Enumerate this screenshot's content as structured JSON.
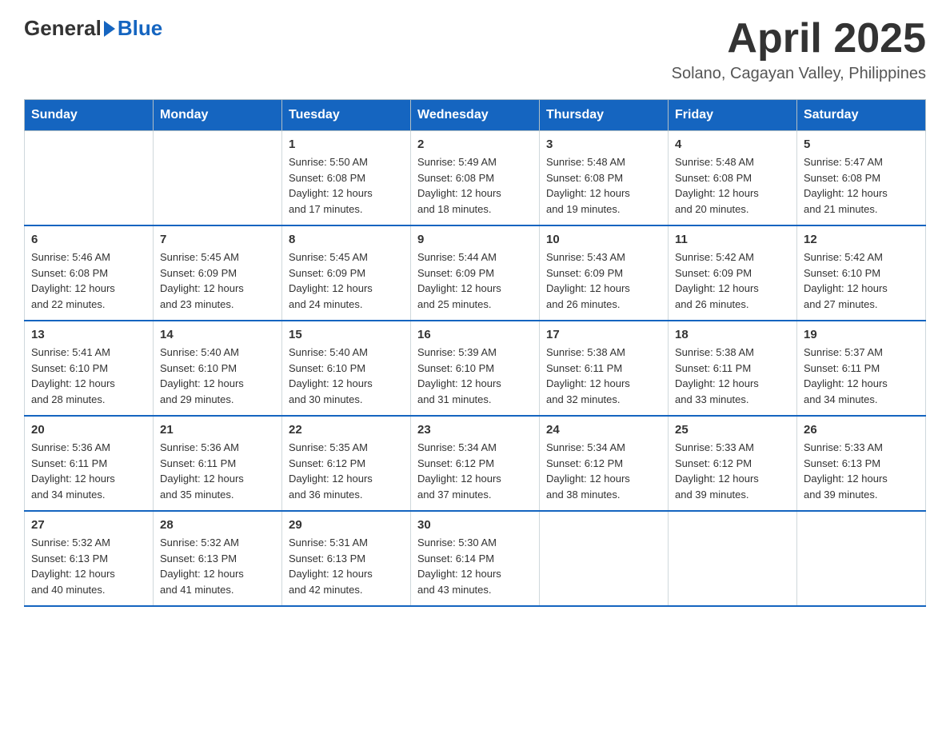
{
  "header": {
    "logo": {
      "general": "General",
      "blue": "Blue"
    },
    "title": "April 2025",
    "subtitle": "Solano, Cagayan Valley, Philippines"
  },
  "calendar": {
    "days_of_week": [
      "Sunday",
      "Monday",
      "Tuesday",
      "Wednesday",
      "Thursday",
      "Friday",
      "Saturday"
    ],
    "weeks": [
      [
        {
          "day": "",
          "info": ""
        },
        {
          "day": "",
          "info": ""
        },
        {
          "day": "1",
          "info": "Sunrise: 5:50 AM\nSunset: 6:08 PM\nDaylight: 12 hours\nand 17 minutes."
        },
        {
          "day": "2",
          "info": "Sunrise: 5:49 AM\nSunset: 6:08 PM\nDaylight: 12 hours\nand 18 minutes."
        },
        {
          "day": "3",
          "info": "Sunrise: 5:48 AM\nSunset: 6:08 PM\nDaylight: 12 hours\nand 19 minutes."
        },
        {
          "day": "4",
          "info": "Sunrise: 5:48 AM\nSunset: 6:08 PM\nDaylight: 12 hours\nand 20 minutes."
        },
        {
          "day": "5",
          "info": "Sunrise: 5:47 AM\nSunset: 6:08 PM\nDaylight: 12 hours\nand 21 minutes."
        }
      ],
      [
        {
          "day": "6",
          "info": "Sunrise: 5:46 AM\nSunset: 6:08 PM\nDaylight: 12 hours\nand 22 minutes."
        },
        {
          "day": "7",
          "info": "Sunrise: 5:45 AM\nSunset: 6:09 PM\nDaylight: 12 hours\nand 23 minutes."
        },
        {
          "day": "8",
          "info": "Sunrise: 5:45 AM\nSunset: 6:09 PM\nDaylight: 12 hours\nand 24 minutes."
        },
        {
          "day": "9",
          "info": "Sunrise: 5:44 AM\nSunset: 6:09 PM\nDaylight: 12 hours\nand 25 minutes."
        },
        {
          "day": "10",
          "info": "Sunrise: 5:43 AM\nSunset: 6:09 PM\nDaylight: 12 hours\nand 26 minutes."
        },
        {
          "day": "11",
          "info": "Sunrise: 5:42 AM\nSunset: 6:09 PM\nDaylight: 12 hours\nand 26 minutes."
        },
        {
          "day": "12",
          "info": "Sunrise: 5:42 AM\nSunset: 6:10 PM\nDaylight: 12 hours\nand 27 minutes."
        }
      ],
      [
        {
          "day": "13",
          "info": "Sunrise: 5:41 AM\nSunset: 6:10 PM\nDaylight: 12 hours\nand 28 minutes."
        },
        {
          "day": "14",
          "info": "Sunrise: 5:40 AM\nSunset: 6:10 PM\nDaylight: 12 hours\nand 29 minutes."
        },
        {
          "day": "15",
          "info": "Sunrise: 5:40 AM\nSunset: 6:10 PM\nDaylight: 12 hours\nand 30 minutes."
        },
        {
          "day": "16",
          "info": "Sunrise: 5:39 AM\nSunset: 6:10 PM\nDaylight: 12 hours\nand 31 minutes."
        },
        {
          "day": "17",
          "info": "Sunrise: 5:38 AM\nSunset: 6:11 PM\nDaylight: 12 hours\nand 32 minutes."
        },
        {
          "day": "18",
          "info": "Sunrise: 5:38 AM\nSunset: 6:11 PM\nDaylight: 12 hours\nand 33 minutes."
        },
        {
          "day": "19",
          "info": "Sunrise: 5:37 AM\nSunset: 6:11 PM\nDaylight: 12 hours\nand 34 minutes."
        }
      ],
      [
        {
          "day": "20",
          "info": "Sunrise: 5:36 AM\nSunset: 6:11 PM\nDaylight: 12 hours\nand 34 minutes."
        },
        {
          "day": "21",
          "info": "Sunrise: 5:36 AM\nSunset: 6:11 PM\nDaylight: 12 hours\nand 35 minutes."
        },
        {
          "day": "22",
          "info": "Sunrise: 5:35 AM\nSunset: 6:12 PM\nDaylight: 12 hours\nand 36 minutes."
        },
        {
          "day": "23",
          "info": "Sunrise: 5:34 AM\nSunset: 6:12 PM\nDaylight: 12 hours\nand 37 minutes."
        },
        {
          "day": "24",
          "info": "Sunrise: 5:34 AM\nSunset: 6:12 PM\nDaylight: 12 hours\nand 38 minutes."
        },
        {
          "day": "25",
          "info": "Sunrise: 5:33 AM\nSunset: 6:12 PM\nDaylight: 12 hours\nand 39 minutes."
        },
        {
          "day": "26",
          "info": "Sunrise: 5:33 AM\nSunset: 6:13 PM\nDaylight: 12 hours\nand 39 minutes."
        }
      ],
      [
        {
          "day": "27",
          "info": "Sunrise: 5:32 AM\nSunset: 6:13 PM\nDaylight: 12 hours\nand 40 minutes."
        },
        {
          "day": "28",
          "info": "Sunrise: 5:32 AM\nSunset: 6:13 PM\nDaylight: 12 hours\nand 41 minutes."
        },
        {
          "day": "29",
          "info": "Sunrise: 5:31 AM\nSunset: 6:13 PM\nDaylight: 12 hours\nand 42 minutes."
        },
        {
          "day": "30",
          "info": "Sunrise: 5:30 AM\nSunset: 6:14 PM\nDaylight: 12 hours\nand 43 minutes."
        },
        {
          "day": "",
          "info": ""
        },
        {
          "day": "",
          "info": ""
        },
        {
          "day": "",
          "info": ""
        }
      ]
    ]
  }
}
